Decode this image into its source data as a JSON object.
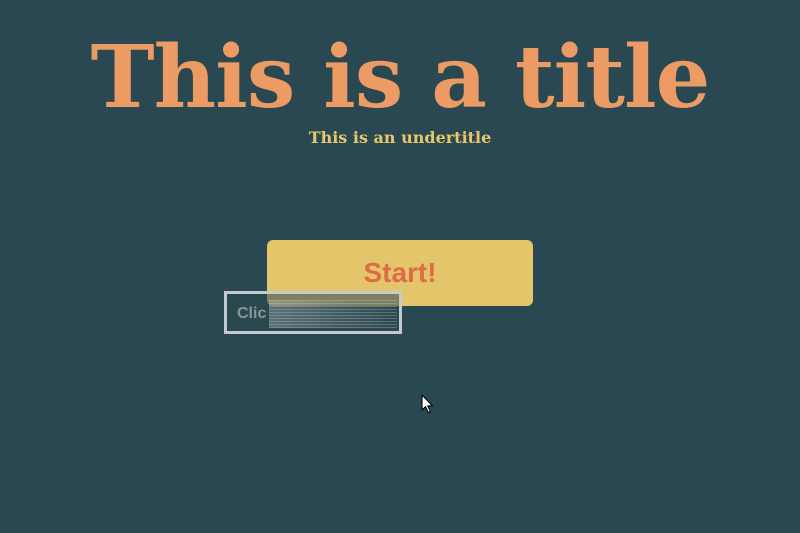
{
  "header": {
    "title": "This is a title",
    "subtitle": "This is an undertitle"
  },
  "main": {
    "start_label": "Start!",
    "hint_text": "Clic"
  },
  "icons": {
    "cursor": "mouse-pointer-icon"
  },
  "colors": {
    "background": "#2a4851",
    "title": "#eb9b63",
    "subtitle": "#e7c76a",
    "button_background": "#e4c56a",
    "button_text": "#df6a4a",
    "hint_border": "#c4cace"
  }
}
